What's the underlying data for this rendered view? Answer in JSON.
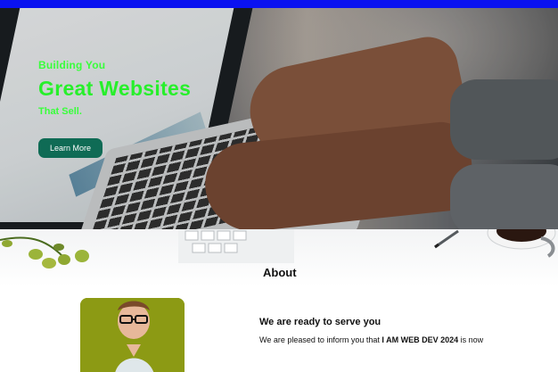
{
  "hero": {
    "pre_title": "Building You",
    "title": "Great Websites",
    "post_title": "That Sell.",
    "cta_label": "Learn More"
  },
  "about": {
    "title": "About",
    "subtitle": "We are ready to serve you",
    "desc_before": "We are pleased to inform you that ",
    "desc_bold": "I AM WEB DEV 2024",
    "desc_after": " is now"
  },
  "colors": {
    "top_bar": "#0a12f0",
    "hero_text": "#27ef2b",
    "cta_background": "#0f6b55",
    "photo_background": "#8c9a14"
  }
}
